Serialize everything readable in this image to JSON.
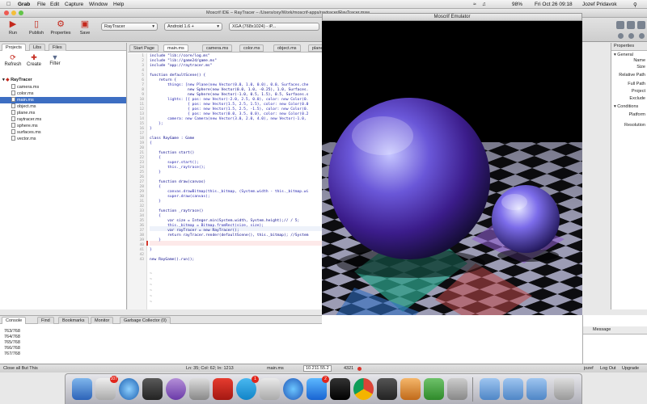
{
  "menubar": {
    "app": "Grab",
    "items": [
      "File",
      "Edit",
      "Capture",
      "Window",
      "Help"
    ],
    "battery": "98%",
    "datetime": "Fri Oct 26 09:18",
    "user": "Jozef Pridavok"
  },
  "ide": {
    "title": "Moscrif IDE – RayTracer – /Users/oxy/Work/moscrif-apps/raytracer/RayTracer.msw"
  },
  "toolbar": {
    "buttons": [
      "Run",
      "Publish",
      "Properties",
      "Save"
    ],
    "project_select": "RayTracer",
    "device_select": "Android 1.6 +",
    "resolution_select": "XGA (768x1024) - iP..."
  },
  "left_panel": {
    "tabs": [
      "Projects",
      "Libs",
      "Files"
    ],
    "actions": [
      "Refresh",
      "Create",
      "Filter"
    ],
    "root": "RayTracer",
    "files": [
      "camera.ms",
      "color.ms",
      "main.ms",
      "object.ms",
      "plane.ms",
      "raytracer.ms",
      "sphere.ms",
      "surfaces.ms",
      "vector.ms"
    ],
    "selected": "main.ms"
  },
  "editor": {
    "tabs": [
      "Start Page",
      "main.ms",
      "camera.ms",
      "color.ms",
      "object.ms",
      "plane.ms"
    ],
    "active_tab": "main.ms",
    "line_numbers": [
      "1",
      "2",
      "3",
      "4",
      "5",
      "6",
      "7",
      "8",
      "9",
      "10",
      "11",
      "12",
      "13",
      "14",
      "15",
      "16",
      "17",
      "18",
      "19",
      "20",
      "21",
      "22",
      "23",
      "24",
      "25",
      "26",
      "27",
      "28",
      "29",
      "30",
      "31",
      "32",
      "33",
      "34",
      "35",
      "36",
      "37",
      "38",
      "39",
      "40",
      "41",
      "42",
      "43"
    ],
    "lines": [
      "include \"lib://core/log.ms\"",
      "include \"lib://game2d/game.ms\"",
      "include \"app://raytracer.ms\"",
      "",
      "function defaultScene() {",
      "    return {",
      "        things: [new Plane(new Vector(0.0, 1.0, 0.0), 0.0, Surfaces.che",
      "                 new Sphere(new Vector(0.0, 1.0, -0.25), 1.0, Surfaces.",
      "                 new Sphere(new Vector(-1.0, 0.5, 1.5), 0.5, Surfaces.s",
      "        lights: [{ pos: new Vector(-2.0, 2.5, 0.0), color: new Color(0.",
      "                 { pos: new Vector(1.5, 2.5, 1.5), color: new Color(0.0",
      "                 { pos: new Vector(1.5, 2.5, -1.5), color: new Color(0.",
      "                 { pos: new Vector(0.0, 3.5, 0.0), color: new Color(0.2",
      "        camera: new Camera(new Vector(3.0, 2.0, 4.0), new Vector(-1.0,",
      "    };",
      "}",
      "",
      "class RayGame : Game",
      "{",
      "",
      "    function start()",
      "    {",
      "        super.start();",
      "        this._raytrace();",
      "    }",
      "",
      "    function draw(canvas)",
      "    {",
      "        canvas.drawBitmap(this._bitmap, (System.width - this._bitmap.wi",
      "        super.draw(canvas);",
      "    }",
      "",
      "    function _raytrace()",
      "    {",
      "        var size = Integer.min(System.width, System.height);// / 5;",
      "        this._bitmap = Bitmap.fromRect(size, size);",
      "        var rayTracer = new RayTracer();",
      "        return rayTracer.render(defaultScene(), this._bitmap); //System",
      "    }",
      "",
      "}",
      "",
      "new RayGame().run();"
    ]
  },
  "emulator": {
    "title": "Moscrif Emulator"
  },
  "properties": {
    "title": "Properties",
    "sections": [
      "General",
      "Conditions"
    ],
    "rows": [
      "Name",
      "Size",
      "Relative Path",
      "Full Path",
      "Project",
      "Exclude",
      "Platform",
      "Resolution"
    ]
  },
  "console": {
    "tabs": [
      "Console",
      "Find",
      "Bookmarks",
      "Monitor",
      "Garbage Collector (0)"
    ],
    "lines": [
      "763/768",
      "764/768",
      "765/768",
      "766/768",
      "767/768"
    ],
    "message_header": "Message"
  },
  "status": {
    "left": "Close all But This",
    "position": "Ln: 35; Col: 62; In: 1213",
    "file": "main.ms",
    "ip": "10.211.55.2",
    "port": "4321",
    "user": "jozef",
    "logout": "Log Out",
    "upgrade": "Upgrade"
  },
  "dock": {
    "badge_mail": "107",
    "badge_skype": "1",
    "badge_appstore": "2"
  }
}
